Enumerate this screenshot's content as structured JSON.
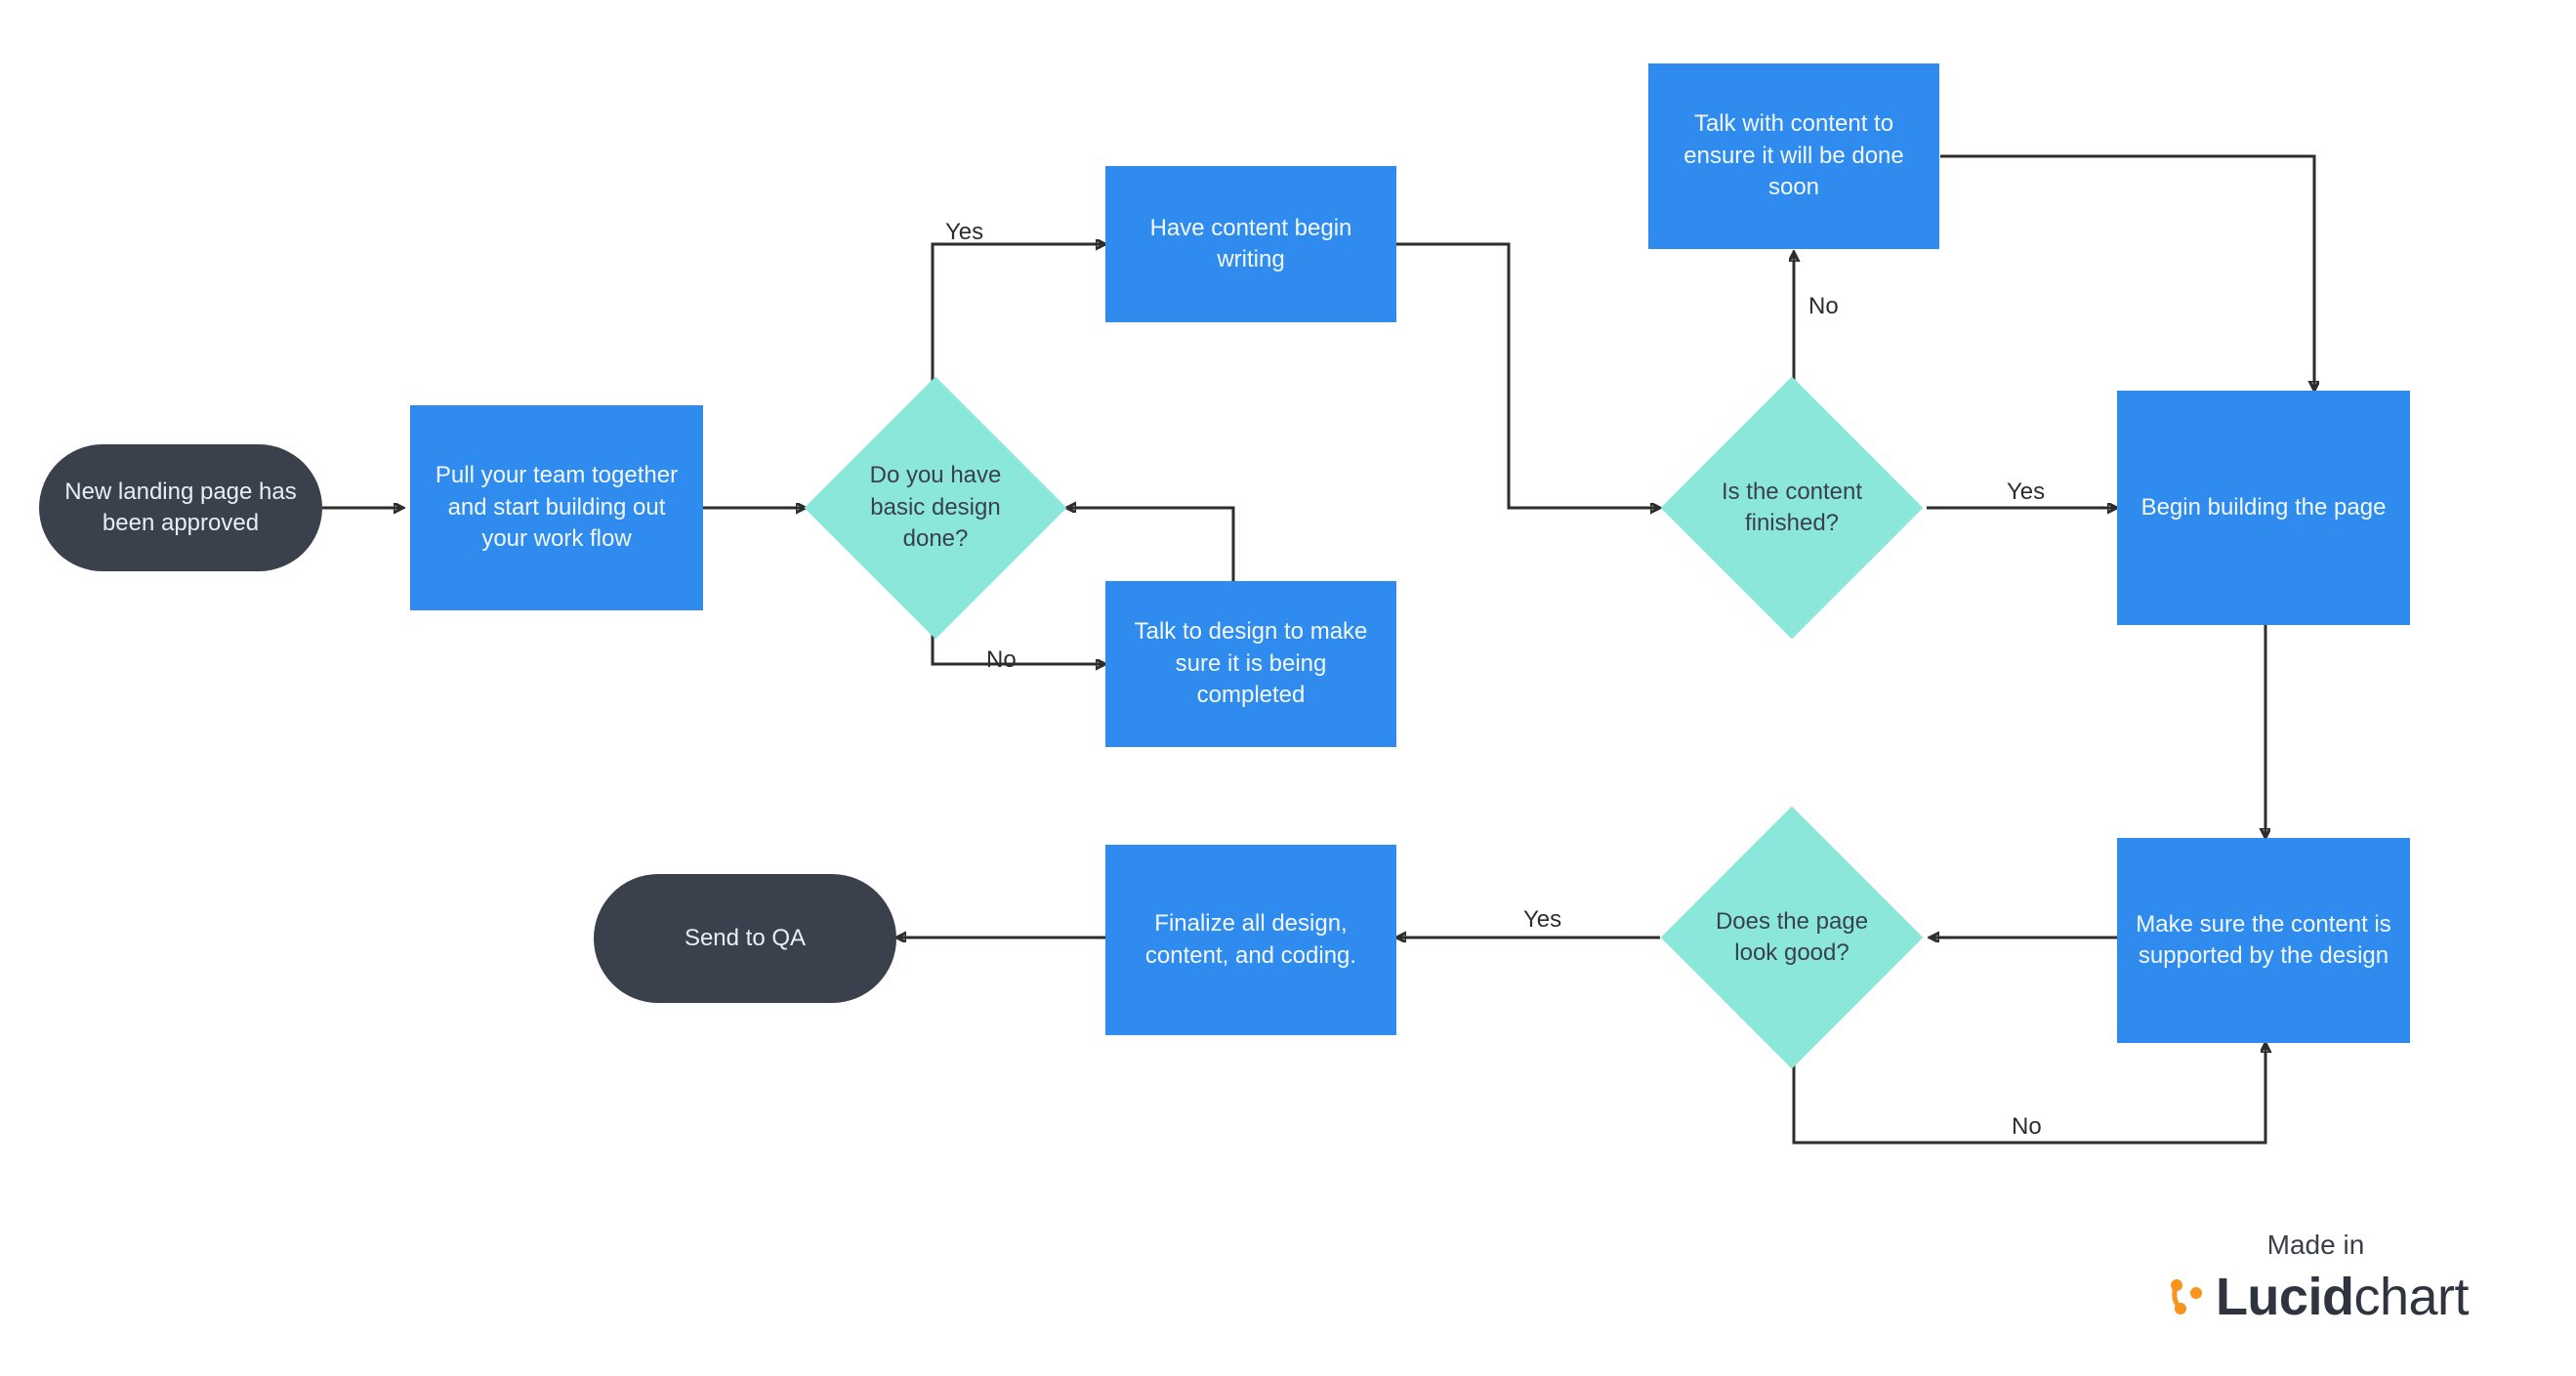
{
  "nodes": {
    "start": {
      "label": "New landing page has been approved"
    },
    "pull_team": {
      "label": "Pull your team together and start building out your work flow"
    },
    "basic_design": {
      "label": "Do you have basic design done?"
    },
    "have_content": {
      "label": "Have content begin writing"
    },
    "talk_design": {
      "label": "Talk to design to make sure it is being completed"
    },
    "content_finished": {
      "label": "Is the content finished?"
    },
    "talk_content": {
      "label": "Talk with content to ensure it will be done soon"
    },
    "begin_build": {
      "label": "Begin building the page"
    },
    "make_sure": {
      "label": "Make sure the content is supported by the design"
    },
    "look_good": {
      "label": "Does the page look good?"
    },
    "finalize": {
      "label": "Finalize all design, content, and coding."
    },
    "send_qa": {
      "label": "Send to QA"
    }
  },
  "edge_labels": {
    "yes1": "Yes",
    "no1": "No",
    "yes2": "Yes",
    "no2": "No",
    "yes3": "Yes",
    "no3": "No"
  },
  "footer": {
    "made_in": "Made in",
    "brand_bold": "Lucid",
    "brand_rest": "chart"
  },
  "colors": {
    "terminator": "#3a414d",
    "process": "#2f8cee",
    "decision": "#8ae7d9",
    "arrow": "#2d2d2d"
  }
}
